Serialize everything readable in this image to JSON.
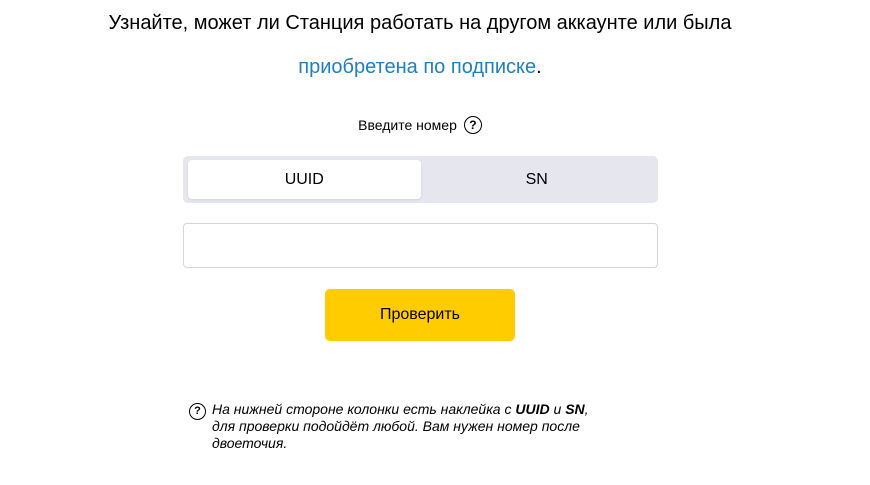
{
  "headline": {
    "text_before_link": "Узнайте, может ли Станция работать на другом аккаунте или была",
    "link_text": "приобретена по подписке",
    "text_after_link": "."
  },
  "form": {
    "enter_number_label": "Введите номер",
    "help_icon_glyph": "?",
    "tabs": [
      {
        "label": "UUID",
        "selected": true
      },
      {
        "label": "SN",
        "selected": false
      }
    ],
    "input_value": "",
    "input_placeholder": "",
    "submit_label": "Проверить"
  },
  "hint": {
    "help_icon_glyph": "?",
    "part1": "На нижней стороне колонки есть наклейка с ",
    "uuid": "UUID",
    "and": " и ",
    "sn": "SN",
    "part2": ",",
    "line2": "для проверки подойдёт любой. Вам нужен номер после",
    "line3": "двоеточия."
  },
  "colors": {
    "link": "#1f7fbf",
    "button": "#ffcc00",
    "segment_bg": "#e5e6ee"
  }
}
